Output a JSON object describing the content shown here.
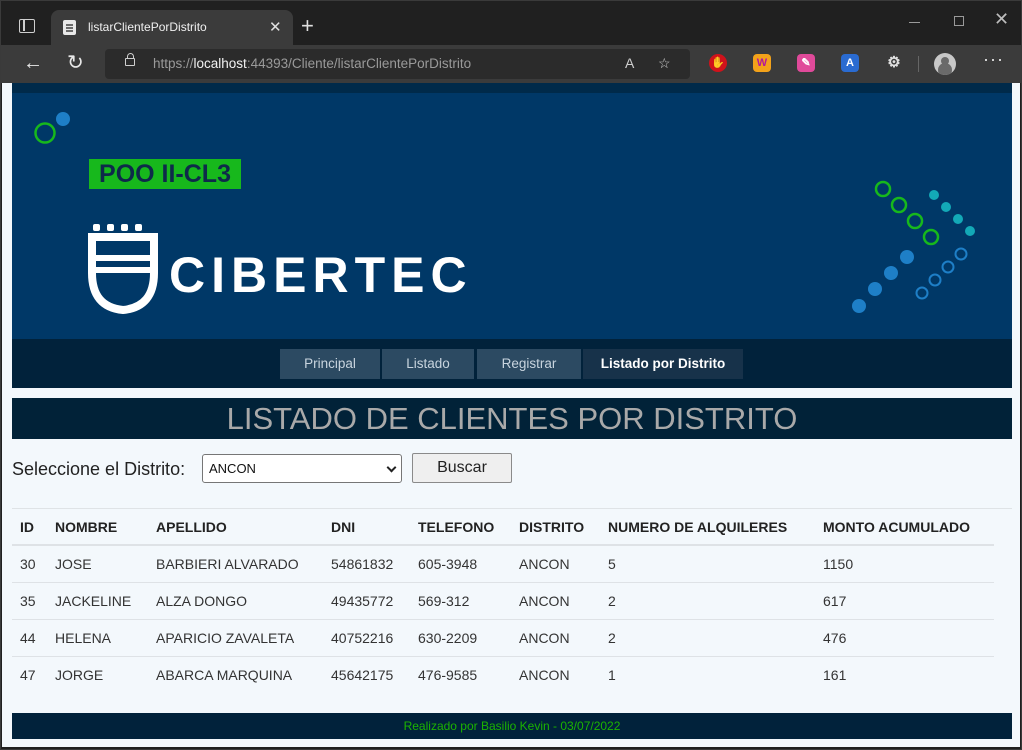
{
  "browser": {
    "tab_title": "listarClientePorDistrito",
    "url_scheme": "https://",
    "url_host": "localhost",
    "url_rest": ":44393/Cliente/listarClientePorDistrito",
    "icons": [
      "window-icon",
      "tab-favicon-icon",
      "close-icon",
      "plus-icon",
      "minimize-icon",
      "maximize-icon",
      "close-window-icon",
      "back-icon",
      "reload-icon",
      "lock-icon",
      "read-aloud-icon",
      "favorite-icon",
      "extension-icon",
      "profile-icon",
      "more-icon"
    ]
  },
  "banner": {
    "badge": "POO II-CL3",
    "brand": "CIBERTEC",
    "colors": {
      "background": "#003867",
      "badge": "#17b81c",
      "accent_green": "#17b81c",
      "accent_blue": "#1e7fc7",
      "accent_teal": "#13a9b7"
    }
  },
  "nav": {
    "items": [
      {
        "label": "Principal"
      },
      {
        "label": "Listado"
      },
      {
        "label": "Registrar"
      },
      {
        "label": "Listado por Distrito"
      }
    ]
  },
  "page": {
    "title": "LISTADO DE CLIENTES POR DISTRITO",
    "filter_label": "Seleccione el Distrito:",
    "selected_district": "ANCON",
    "search_button": "Buscar"
  },
  "table": {
    "headers": [
      "ID",
      "NOMBRE",
      "APELLIDO",
      "DNI",
      "TELEFONO",
      "DISTRITO",
      "NUMERO DE ALQUILERES",
      "MONTO ACUMULADO"
    ],
    "rows": [
      [
        "30",
        "JOSE",
        "BARBIERI ALVARADO",
        "54861832",
        "605-3948",
        "ANCON",
        "5",
        "1150"
      ],
      [
        "35",
        "JACKELINE",
        "ALZA DONGO",
        "49435772",
        "569-312",
        "ANCON",
        "2",
        "617"
      ],
      [
        "44",
        "HELENA",
        "APARICIO ZAVALETA",
        "40752216",
        "630-2209",
        "ANCON",
        "2",
        "476"
      ],
      [
        "47",
        "JORGE",
        "ABARCA MARQUINA",
        "45642175",
        "476-9585",
        "ANCON",
        "1",
        "161"
      ]
    ]
  },
  "footer": {
    "text": "Realizado por Basilio Kevin - 03/07/2022"
  }
}
